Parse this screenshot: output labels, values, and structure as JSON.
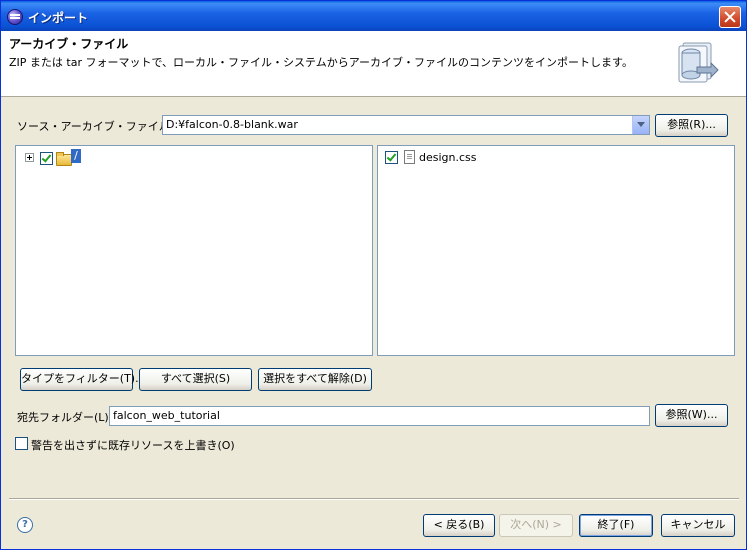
{
  "window": {
    "title": "インポート"
  },
  "header": {
    "title": "アーカイブ・ファイル",
    "description": "ZIP または tar フォーマットで、ローカル・ファイル・システムからアーカイブ・ファイルのコンテンツをインポートします。"
  },
  "source": {
    "label": "ソース・アーカイブ・ファイル(A):",
    "value": "D:¥falcon-0.8-blank.war",
    "browse_label": "参照(R)..."
  },
  "tree": {
    "root_label": "/",
    "root_checked": true
  },
  "files": [
    {
      "name": "design.css",
      "checked": true
    }
  ],
  "buttons": {
    "filter_types": "タイプをフィルター(T)...",
    "select_all": "すべて選択(S)",
    "deselect_all": "選択をすべて解除(D)"
  },
  "destination": {
    "label": "宛先フォルダー(L):",
    "value": "falcon_web_tutorial",
    "browse_label": "参照(W)..."
  },
  "overwrite": {
    "label": "警告を出さずに既存リソースを上書き(O)",
    "checked": false
  },
  "footer": {
    "back": "< 戻る(B)",
    "next": "次へ(N) >",
    "finish": "終了(F)",
    "cancel": "キャンセル"
  }
}
